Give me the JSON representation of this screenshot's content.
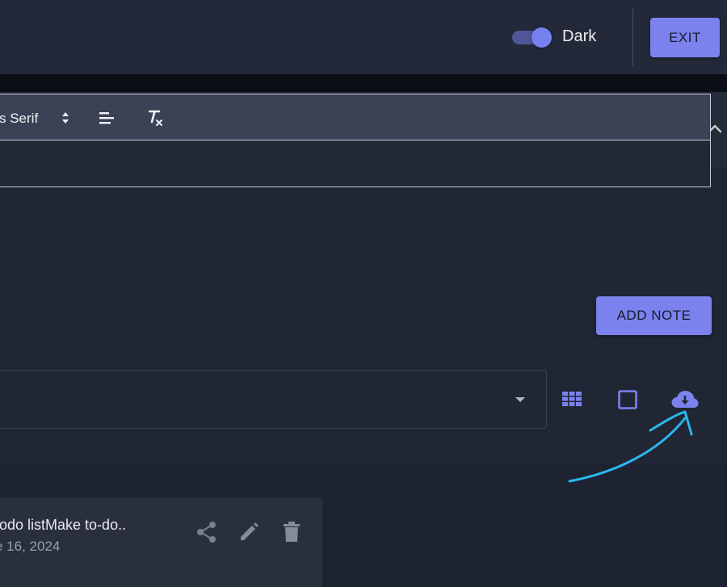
{
  "header": {
    "theme_toggle_label": "Dark",
    "exit_label": "EXIT"
  },
  "editor": {
    "font_picker_label": "s Serif"
  },
  "form": {
    "add_note_label": "ADD NOTE"
  },
  "notes": [
    {
      "title": "todo listMake to-do..",
      "date": "e 16, 2024"
    }
  ],
  "colors": {
    "accent": "#7b82ee",
    "annotation": "#2ab8ef",
    "background": "#1e2331"
  },
  "icons": {
    "collapse": "chevron-up-icon",
    "font_size": "sort-arrows-icon",
    "align": "align-left-icon",
    "clear_format": "clear-format-icon",
    "dropdown": "caret-down-icon",
    "grid_view": "grid-icon",
    "single_view": "square-icon",
    "download": "cloud-download-icon",
    "share": "share-icon",
    "edit": "pencil-icon",
    "delete": "trash-icon"
  }
}
